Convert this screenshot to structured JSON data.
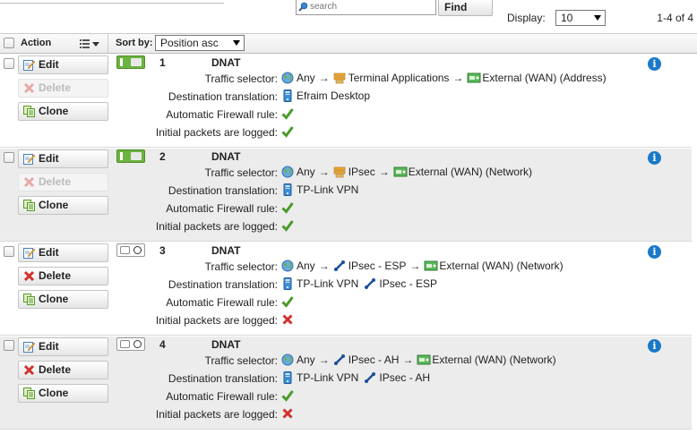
{
  "search": {
    "placeholder": "search",
    "find_label": "Find"
  },
  "display": {
    "label": "Display:",
    "value": "10",
    "count": "1-4 of 4"
  },
  "header": {
    "action_label": "Action",
    "sort_label": "Sort by:",
    "sort_value": "Position asc"
  },
  "labels": {
    "edit": "Edit",
    "delete": "Delete",
    "clone": "Clone",
    "traffic_selector": "Traffic selector:",
    "destination_translation": "Destination translation:",
    "auto_fw": "Automatic Firewall rule:",
    "logged": "Initial packets are logged:"
  },
  "colors": {
    "enabled_toggle": "#6db33f",
    "info": "#1a78c8",
    "check": "#4a9a2a",
    "cross": "#d0312d"
  },
  "rules": [
    {
      "position": "1",
      "type": "DNAT",
      "enabled": true,
      "delete_enabled": false,
      "ts_any": "Any",
      "ts_service": "Terminal Applications",
      "ts_service_icon": "service-group-icon",
      "ts_interface": "External (WAN) (Address)",
      "dt_host": "Efraim Desktop",
      "dt_service": "",
      "auto_fw": true,
      "logged": true
    },
    {
      "position": "2",
      "type": "DNAT",
      "enabled": true,
      "delete_enabled": false,
      "ts_any": "Any",
      "ts_service": "IPsec",
      "ts_service_icon": "service-group-icon",
      "ts_interface": "External (WAN) (Network)",
      "dt_host": "TP-Link VPN",
      "dt_service": "",
      "auto_fw": true,
      "logged": true
    },
    {
      "position": "3",
      "type": "DNAT",
      "enabled": false,
      "delete_enabled": true,
      "ts_any": "Any",
      "ts_service": "IPsec - ESP",
      "ts_service_icon": "service-protocol-icon",
      "ts_interface": "External (WAN) (Network)",
      "dt_host": "TP-Link VPN",
      "dt_service": "IPsec - ESP",
      "auto_fw": true,
      "logged": false
    },
    {
      "position": "4",
      "type": "DNAT",
      "enabled": false,
      "delete_enabled": true,
      "ts_any": "Any",
      "ts_service": "IPsec - AH",
      "ts_service_icon": "service-protocol-icon",
      "ts_interface": "External (WAN) (Network)",
      "dt_host": "TP-Link VPN",
      "dt_service": "IPsec - AH",
      "auto_fw": true,
      "logged": false
    }
  ]
}
